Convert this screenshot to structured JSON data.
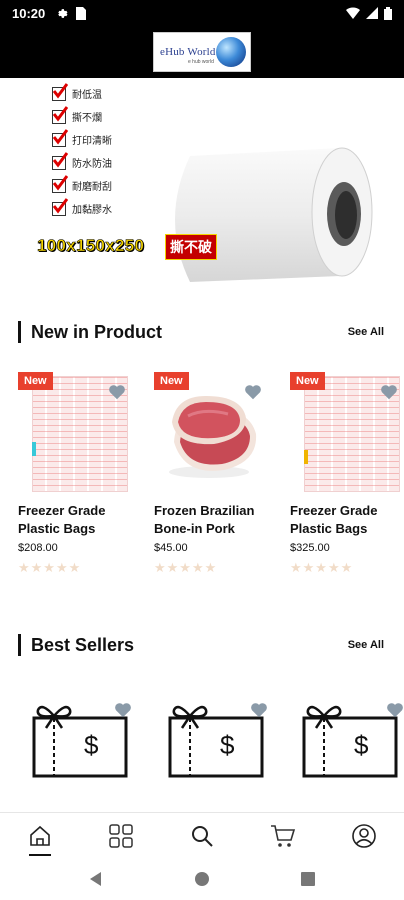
{
  "status_bar": {
    "time": "10:20",
    "icons": [
      "gear-icon",
      "sim-card-icon",
      "wifi-icon",
      "signal-icon",
      "battery-icon"
    ]
  },
  "header": {
    "logo_text": "eHub World",
    "logo_subtext": "e hub world"
  },
  "banner": {
    "features": [
      "耐低温",
      "撕不爛",
      "打印清晰",
      "防水防油",
      "耐磨耐刮",
      "加黏膠水"
    ],
    "size_text": "100x150x250",
    "tag_text": "撕不破"
  },
  "new_in_product": {
    "title": "New in Product",
    "see_all": "See All",
    "products": [
      {
        "name": "Freezer Grade Plastic Bags",
        "price": "$208.00",
        "badge": "New",
        "rating": 0,
        "image": "plastic-bags"
      },
      {
        "name": "Frozen Brazilian Bone-in Pork",
        "price": "$45.00",
        "badge": "New",
        "rating": 0,
        "image": "pork"
      },
      {
        "name": "Freezer Grade Plastic Bags",
        "price": "$325.00",
        "badge": "New",
        "rating": 0,
        "image": "plastic-bags"
      }
    ]
  },
  "best_sellers": {
    "title": "Best Sellers",
    "see_all": "See All",
    "items": [
      {
        "image": "gift-card-icon",
        "currency_symbol": "$"
      },
      {
        "image": "gift-card-icon",
        "currency_symbol": "$"
      },
      {
        "image": "gift-card-icon",
        "currency_symbol": "$"
      }
    ]
  },
  "bottom_nav": {
    "items": [
      "home-icon",
      "categories-icon",
      "search-icon",
      "cart-icon",
      "account-icon"
    ],
    "active": "home-icon"
  },
  "colors": {
    "badge": "#e8402d",
    "heart": "#8a9aa8",
    "star_empty": "#f1dcc8",
    "header_bg": "#000000"
  }
}
